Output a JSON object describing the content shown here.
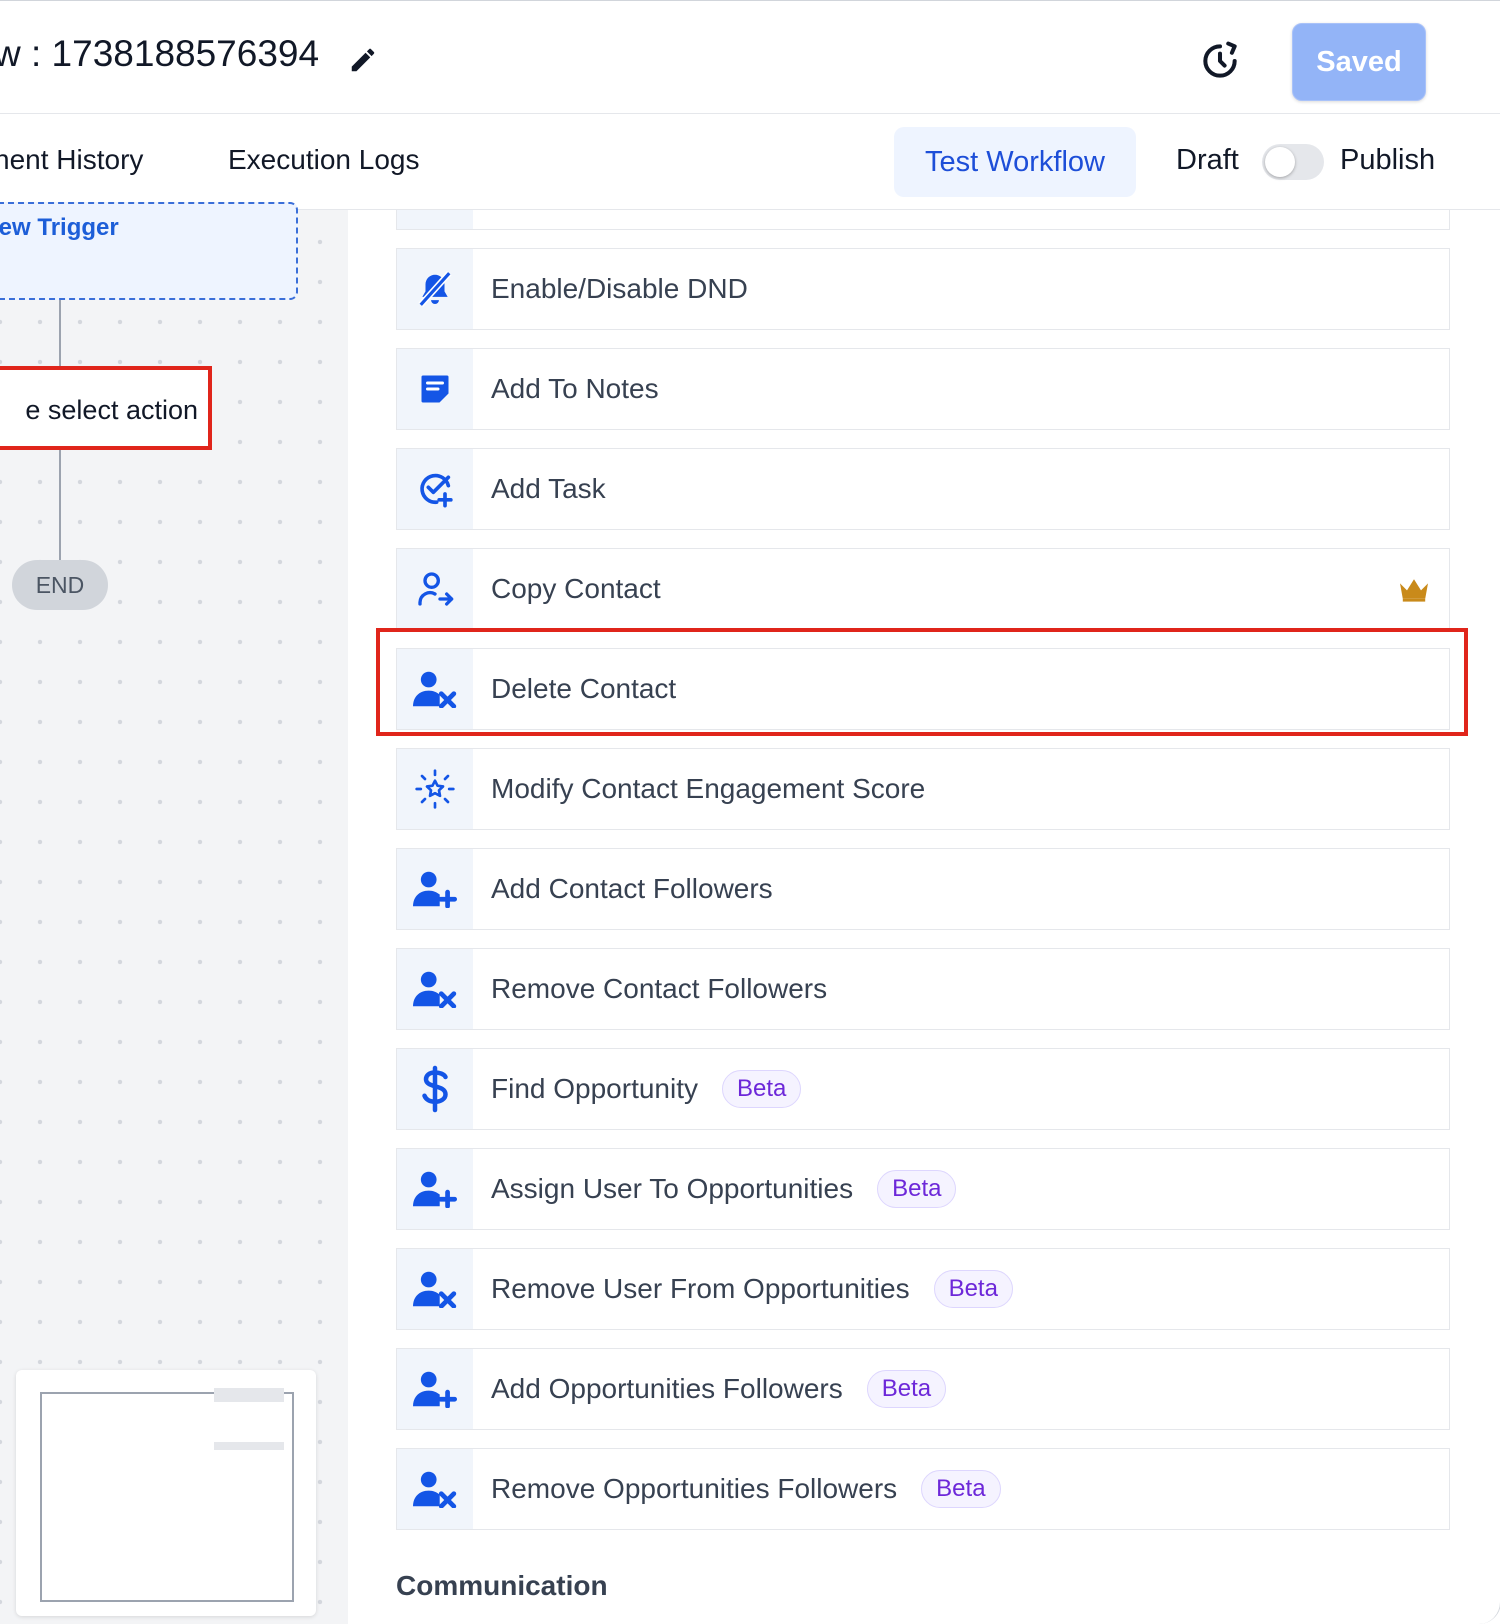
{
  "header": {
    "title": "w : 1738188576394",
    "saved_label": "Saved"
  },
  "tabs": {
    "history": "nent History",
    "logs": "Execution Logs"
  },
  "controls": {
    "test_workflow": "Test Workflow",
    "draft": "Draft",
    "publish": "Publish",
    "published": false
  },
  "canvas": {
    "trigger_text": "lew Trigger",
    "action_text": "e select action",
    "end_label": "END"
  },
  "actions": [
    {
      "label": "",
      "icon": "partial-icon"
    },
    {
      "label": "Enable/Disable DND",
      "icon": "bell-off-icon"
    },
    {
      "label": "Add To Notes",
      "icon": "note-icon"
    },
    {
      "label": "Add Task",
      "icon": "task-check-icon"
    },
    {
      "label": "Copy Contact",
      "icon": "user-arrow-icon",
      "premium": true
    },
    {
      "label": "Delete Contact",
      "icon": "user-x-icon",
      "highlighted": true
    },
    {
      "label": "Modify Contact Engagement Score",
      "icon": "sparkle-star-icon"
    },
    {
      "label": "Add Contact Followers",
      "icon": "user-plus-icon"
    },
    {
      "label": "Remove Contact Followers",
      "icon": "user-x-icon"
    },
    {
      "label": "Find Opportunity",
      "icon": "dollar-icon",
      "badge": "Beta"
    },
    {
      "label": "Assign User To Opportunities",
      "icon": "user-plus-icon",
      "badge": "Beta"
    },
    {
      "label": "Remove User From Opportunities",
      "icon": "user-x-icon",
      "badge": "Beta"
    },
    {
      "label": "Add Opportunities Followers",
      "icon": "user-plus-icon",
      "badge": "Beta"
    },
    {
      "label": "Remove Opportunities Followers",
      "icon": "user-x-icon",
      "badge": "Beta"
    }
  ],
  "section_next": "Communication",
  "colors": {
    "accent": "#1d4ed8",
    "icon_blue": "#1455e6",
    "highlight_red": "#e0251b",
    "beta_purple": "#6d28d9",
    "saved_bg": "#93b4f7",
    "crown_gold": "#c98a1a"
  }
}
